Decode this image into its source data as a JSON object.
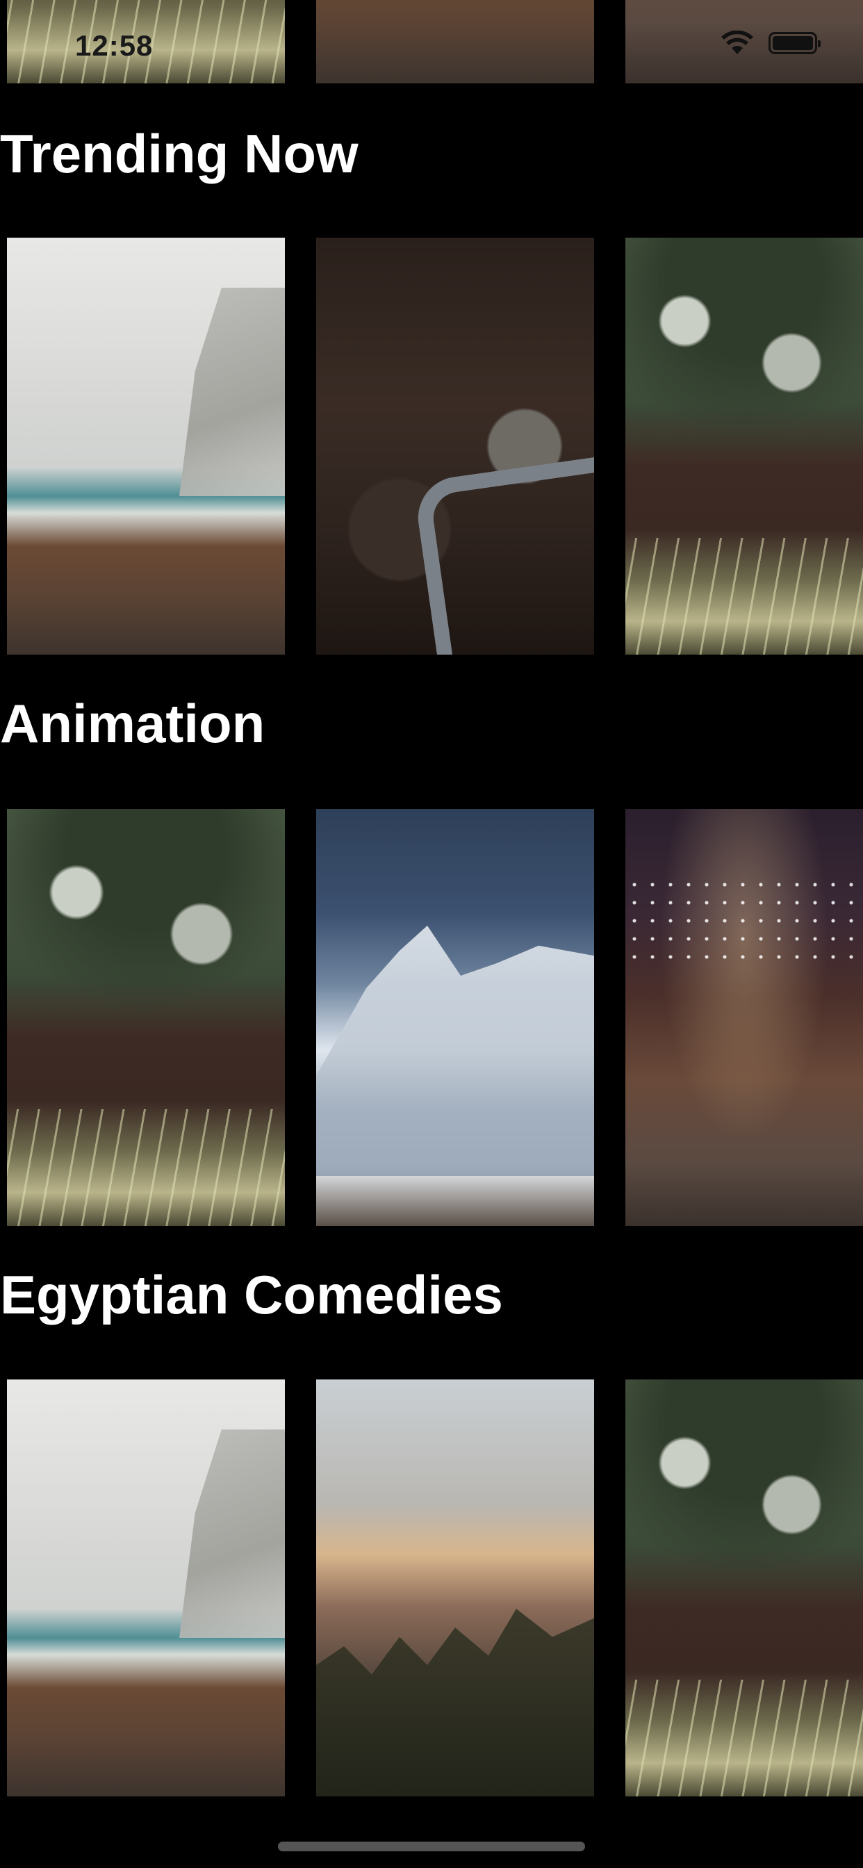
{
  "status_bar": {
    "time": "12:58",
    "wifi_icon": "wifi-icon",
    "battery_icon": "battery-icon"
  },
  "top_row": {
    "posters": [
      "grass",
      "beach",
      "street"
    ]
  },
  "sections": [
    {
      "title": "Trending Now",
      "posters": [
        "beach",
        "machine",
        "grass"
      ]
    },
    {
      "title": "Animation",
      "posters": [
        "grass",
        "mountain",
        "street"
      ]
    },
    {
      "title": "Egyptian Comedies",
      "posters": [
        "beach",
        "sunset",
        "grass"
      ]
    }
  ]
}
